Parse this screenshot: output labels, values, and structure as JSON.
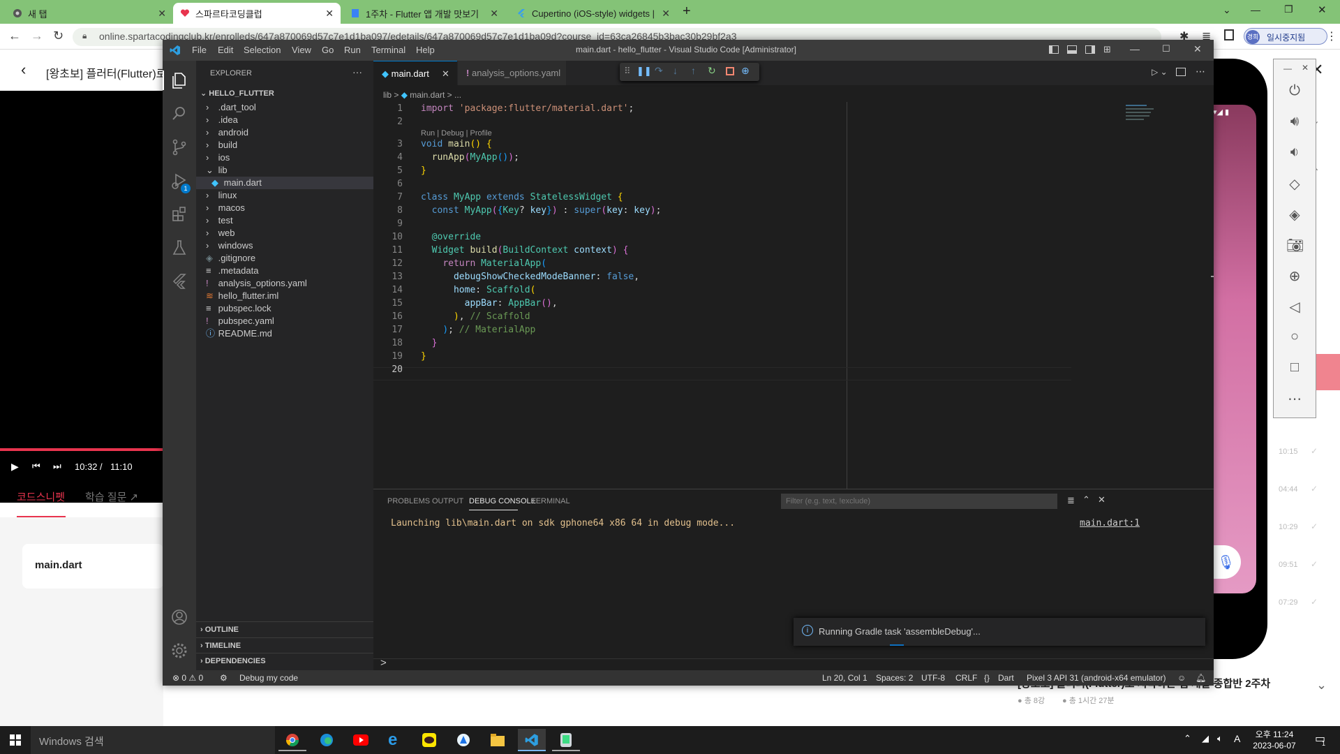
{
  "browser": {
    "tabs": [
      {
        "label": "새 탭",
        "active": false
      },
      {
        "label": "스파르타코딩클럽",
        "active": true
      },
      {
        "label": "1주차 - Flutter 앱 개발 맛보기",
        "active": false
      },
      {
        "label": "Cupertino (iOS-style) widgets |",
        "active": false
      }
    ],
    "new_tab": "+",
    "url": "online.spartacodingclub.kr/enrolleds/647a870069d57c7e1d1ba097/edetails/647a870069d57c7e1d1ba09d?course_id=63ca26845b3bac30b29bf2a3",
    "profile": "일시중지됨",
    "profile_avatar": "경희"
  },
  "lecture": {
    "title": "[왕초보] 플러터(Flutter)로",
    "time_current": "10:32",
    "time_sep": "/",
    "time_total": "11:10",
    "tab_snippet": "코드스니펫",
    "tab_question": "학습 질문",
    "snippet_file": "main.dart"
  },
  "right_panel": {
    "times": [
      "10:15",
      "04:44",
      "10:29",
      "09:51",
      "07:29"
    ],
    "course_title": "[왕초보] 플러터(Flutter)로 시작하는 앱 개발 종합반 2주차",
    "lessons": "총 8강",
    "duration": "총 1시간 27분"
  },
  "vscode": {
    "title": "main.dart - hello_flutter - Visual Studio Code [Administrator]",
    "menu": [
      "File",
      "Edit",
      "Selection",
      "View",
      "Go",
      "Run",
      "Terminal",
      "Help"
    ],
    "explorer_label": "EXPLORER",
    "explorer_more": "···",
    "project": "HELLO_FLUTTER",
    "tree": [
      {
        "name": ".dart_tool",
        "type": "folder",
        "depth": 0
      },
      {
        "name": ".idea",
        "type": "folder",
        "depth": 0
      },
      {
        "name": "android",
        "type": "folder",
        "depth": 0
      },
      {
        "name": "build",
        "type": "folder",
        "depth": 0
      },
      {
        "name": "ios",
        "type": "folder",
        "depth": 0
      },
      {
        "name": "lib",
        "type": "folder-open",
        "depth": 0
      },
      {
        "name": "main.dart",
        "type": "dart",
        "depth": 1
      },
      {
        "name": "linux",
        "type": "folder",
        "depth": 0
      },
      {
        "name": "macos",
        "type": "folder",
        "depth": 0
      },
      {
        "name": "test",
        "type": "folder",
        "depth": 0
      },
      {
        "name": "web",
        "type": "folder",
        "depth": 0
      },
      {
        "name": "windows",
        "type": "folder",
        "depth": 0
      },
      {
        "name": ".gitignore",
        "type": "git",
        "depth": 0
      },
      {
        "name": ".metadata",
        "type": "meta",
        "depth": 0
      },
      {
        "name": "analysis_options.yaml",
        "type": "yaml",
        "depth": 0
      },
      {
        "name": "hello_flutter.iml",
        "type": "iml",
        "depth": 0
      },
      {
        "name": "pubspec.lock",
        "type": "meta",
        "depth": 0
      },
      {
        "name": "pubspec.yaml",
        "type": "yaml",
        "depth": 0
      },
      {
        "name": "README.md",
        "type": "info",
        "depth": 0
      }
    ],
    "sections": [
      "OUTLINE",
      "TIMELINE",
      "DEPENDENCIES"
    ],
    "editor_tabs": [
      {
        "label": "main.dart",
        "active": true
      },
      {
        "label": "analysis_options.yaml",
        "active": false
      }
    ],
    "breadcrumb": [
      "lib",
      ">",
      "main.dart",
      ">",
      "..."
    ],
    "codelens": "Run | Debug | Profile",
    "panel_tabs": [
      "PROBLEMS",
      "OUTPUT",
      "DEBUG CONSOLE",
      "TERMINAL"
    ],
    "filter_placeholder": "Filter (e.g. text, !exclude)",
    "console_line": "Launching lib\\main.dart on sdk gphone64 x86 64 in debug mode...",
    "console_link": "main.dart:1",
    "prompt": ">",
    "notification": "Running Gradle task 'assembleDebug'...",
    "status": {
      "errors": "0",
      "warnings": "0",
      "debug": "Debug my code",
      "position": "Ln 20, Col 1",
      "spaces": "Spaces: 2",
      "encoding": "UTF-8",
      "eol": "CRLF",
      "lang_brace": "{}",
      "language": "Dart",
      "device": "Pixel 3 API 31 (android-x64 emulator)"
    },
    "debug_badge": "1"
  },
  "taskbar": {
    "search": "Windows 검색",
    "time": "오후 11:24",
    "date": "2023-06-07",
    "ime": "A",
    "notif_count": "1"
  },
  "colors": {
    "chrome_green": "#84c377",
    "vscode_blue": "#007acc",
    "accent_red": "#e8344e"
  }
}
